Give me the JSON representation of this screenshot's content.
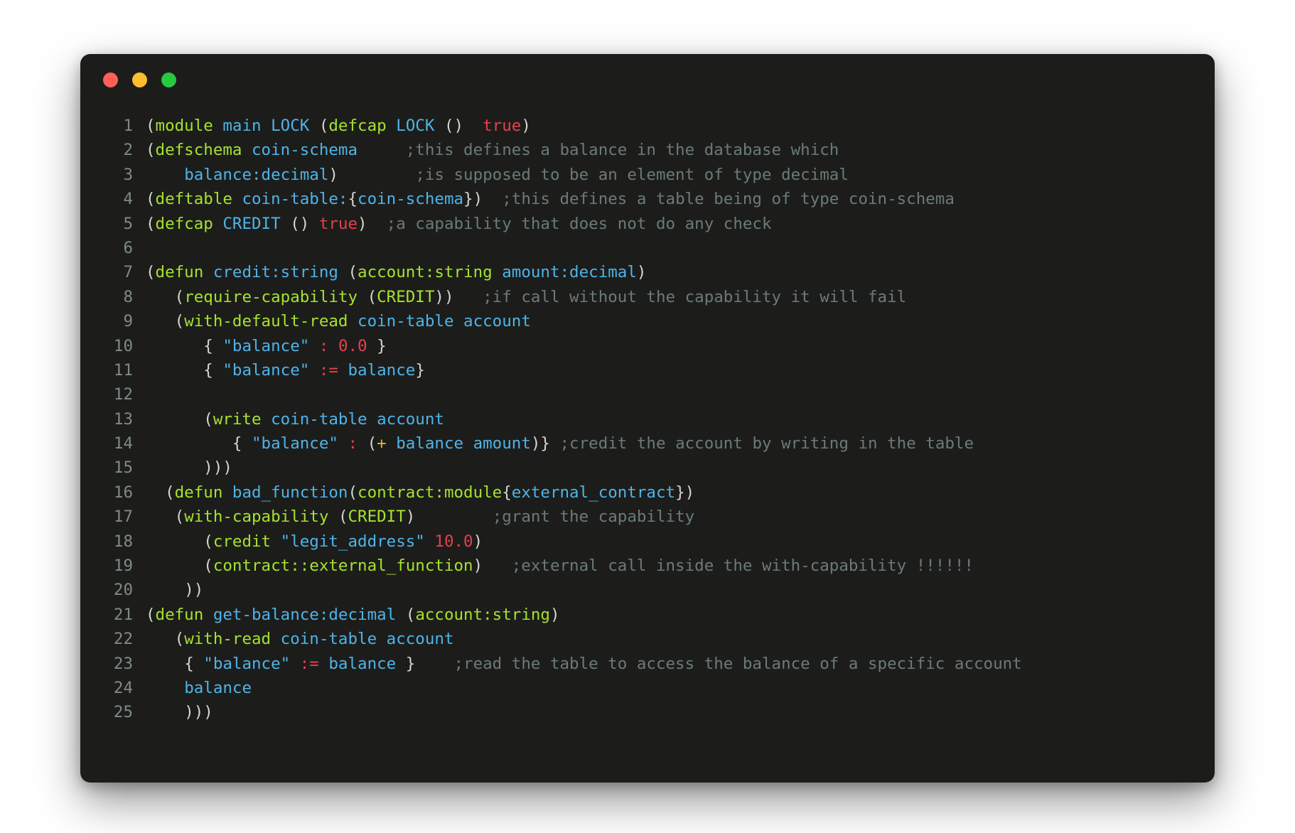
{
  "window": {
    "traffic_lights": [
      {
        "name": "close-button",
        "color": "#ff5f56"
      },
      {
        "name": "minimize-button",
        "color": "#ffbd2e"
      },
      {
        "name": "maximize-button",
        "color": "#27c93f"
      }
    ]
  },
  "editor": {
    "language": "pact",
    "background": "#1c1d1b",
    "gutter_color": "#7d8b87",
    "palette": {
      "keyword": "#a6e22e",
      "identifier": "#4fb3e8",
      "string": "#4fb3e8",
      "number": "#e5404a",
      "literal": "#e5404a",
      "operator": "#e5404a",
      "arith_operator": "#e6b422",
      "punctuation": "#d6d6d0",
      "comment": "#6b7a78"
    },
    "lines": [
      {
        "number": "1",
        "tokens": [
          {
            "t": "(",
            "c": "punc"
          },
          {
            "t": "module",
            "c": "kw"
          },
          {
            "t": " ",
            "c": "plain"
          },
          {
            "t": "main LOCK",
            "c": "id"
          },
          {
            "t": " ",
            "c": "plain"
          },
          {
            "t": "(",
            "c": "punc"
          },
          {
            "t": "defcap",
            "c": "kw"
          },
          {
            "t": " ",
            "c": "plain"
          },
          {
            "t": "LOCK",
            "c": "id"
          },
          {
            "t": " ",
            "c": "plain"
          },
          {
            "t": "()",
            "c": "punc"
          },
          {
            "t": "  ",
            "c": "plain"
          },
          {
            "t": "true",
            "c": "lit"
          },
          {
            "t": ")",
            "c": "punc"
          }
        ]
      },
      {
        "number": "2",
        "tokens": [
          {
            "t": "(",
            "c": "punc"
          },
          {
            "t": "defschema",
            "c": "kw"
          },
          {
            "t": " ",
            "c": "plain"
          },
          {
            "t": "coin-schema",
            "c": "id"
          },
          {
            "t": "     ",
            "c": "plain"
          },
          {
            "t": ";this defines a balance in the database which",
            "c": "cmt"
          }
        ]
      },
      {
        "number": "3",
        "tokens": [
          {
            "t": "    ",
            "c": "plain"
          },
          {
            "t": "balance:decimal",
            "c": "id"
          },
          {
            "t": ")",
            "c": "punc"
          },
          {
            "t": "        ",
            "c": "plain"
          },
          {
            "t": ";is supposed to be an element of type decimal",
            "c": "cmt"
          }
        ]
      },
      {
        "number": "4",
        "tokens": [
          {
            "t": "(",
            "c": "punc"
          },
          {
            "t": "deftable",
            "c": "kw"
          },
          {
            "t": " ",
            "c": "plain"
          },
          {
            "t": "coin-table:",
            "c": "id"
          },
          {
            "t": "{",
            "c": "punc"
          },
          {
            "t": "coin-schema",
            "c": "id"
          },
          {
            "t": "})",
            "c": "punc"
          },
          {
            "t": "  ",
            "c": "plain"
          },
          {
            "t": ";this defines a table being of type coin-schema",
            "c": "cmt"
          }
        ]
      },
      {
        "number": "5",
        "tokens": [
          {
            "t": "(",
            "c": "punc"
          },
          {
            "t": "defcap",
            "c": "kw"
          },
          {
            "t": " ",
            "c": "plain"
          },
          {
            "t": "CREDIT",
            "c": "id"
          },
          {
            "t": " ",
            "c": "plain"
          },
          {
            "t": "()",
            "c": "punc"
          },
          {
            "t": " ",
            "c": "plain"
          },
          {
            "t": "true",
            "c": "lit"
          },
          {
            "t": ")",
            "c": "punc"
          },
          {
            "t": "  ",
            "c": "plain"
          },
          {
            "t": ";a capability that does not do any check",
            "c": "cmt"
          }
        ]
      },
      {
        "number": "6",
        "tokens": []
      },
      {
        "number": "7",
        "tokens": [
          {
            "t": "(",
            "c": "punc"
          },
          {
            "t": "defun",
            "c": "kw"
          },
          {
            "t": " ",
            "c": "plain"
          },
          {
            "t": "credit:string",
            "c": "id"
          },
          {
            "t": " ",
            "c": "plain"
          },
          {
            "t": "(",
            "c": "punc"
          },
          {
            "t": "account:string",
            "c": "kw"
          },
          {
            "t": " ",
            "c": "plain"
          },
          {
            "t": "amount:decimal",
            "c": "id"
          },
          {
            "t": ")",
            "c": "punc"
          }
        ]
      },
      {
        "number": "8",
        "tokens": [
          {
            "t": "   ",
            "c": "plain"
          },
          {
            "t": "(",
            "c": "punc"
          },
          {
            "t": "require-capability",
            "c": "kw"
          },
          {
            "t": " ",
            "c": "plain"
          },
          {
            "t": "(",
            "c": "punc"
          },
          {
            "t": "CREDIT",
            "c": "kw"
          },
          {
            "t": "))",
            "c": "punc"
          },
          {
            "t": "   ",
            "c": "plain"
          },
          {
            "t": ";if call without the capability it will fail",
            "c": "cmt"
          }
        ]
      },
      {
        "number": "9",
        "tokens": [
          {
            "t": "   ",
            "c": "plain"
          },
          {
            "t": "(",
            "c": "punc"
          },
          {
            "t": "with-default-read",
            "c": "kw"
          },
          {
            "t": " ",
            "c": "plain"
          },
          {
            "t": "coin-table account",
            "c": "id"
          }
        ]
      },
      {
        "number": "10",
        "tokens": [
          {
            "t": "      ",
            "c": "plain"
          },
          {
            "t": "{",
            "c": "punc"
          },
          {
            "t": " ",
            "c": "plain"
          },
          {
            "t": "\"balance\"",
            "c": "str"
          },
          {
            "t": " ",
            "c": "plain"
          },
          {
            "t": ":",
            "c": "op"
          },
          {
            "t": " ",
            "c": "plain"
          },
          {
            "t": "0.0",
            "c": "num"
          },
          {
            "t": " ",
            "c": "plain"
          },
          {
            "t": "}",
            "c": "punc"
          }
        ]
      },
      {
        "number": "11",
        "tokens": [
          {
            "t": "      ",
            "c": "plain"
          },
          {
            "t": "{",
            "c": "punc"
          },
          {
            "t": " ",
            "c": "plain"
          },
          {
            "t": "\"balance\"",
            "c": "str"
          },
          {
            "t": " ",
            "c": "plain"
          },
          {
            "t": ":=",
            "c": "op"
          },
          {
            "t": " ",
            "c": "plain"
          },
          {
            "t": "balance",
            "c": "id"
          },
          {
            "t": "}",
            "c": "punc"
          }
        ]
      },
      {
        "number": "12",
        "tokens": []
      },
      {
        "number": "13",
        "tokens": [
          {
            "t": "      ",
            "c": "plain"
          },
          {
            "t": "(",
            "c": "punc"
          },
          {
            "t": "write",
            "c": "kw"
          },
          {
            "t": " ",
            "c": "plain"
          },
          {
            "t": "coin-table account",
            "c": "id"
          }
        ]
      },
      {
        "number": "14",
        "tokens": [
          {
            "t": "         ",
            "c": "plain"
          },
          {
            "t": "{",
            "c": "punc"
          },
          {
            "t": " ",
            "c": "plain"
          },
          {
            "t": "\"balance\"",
            "c": "str"
          },
          {
            "t": " ",
            "c": "plain"
          },
          {
            "t": ":",
            "c": "op"
          },
          {
            "t": " ",
            "c": "plain"
          },
          {
            "t": "(",
            "c": "punc"
          },
          {
            "t": "+",
            "c": "plus"
          },
          {
            "t": " ",
            "c": "plain"
          },
          {
            "t": "balance amount",
            "c": "id"
          },
          {
            "t": ")}",
            "c": "punc"
          },
          {
            "t": " ",
            "c": "plain"
          },
          {
            "t": ";credit the account by writing in the table",
            "c": "cmt"
          }
        ]
      },
      {
        "number": "15",
        "tokens": [
          {
            "t": "      ",
            "c": "plain"
          },
          {
            "t": ")))",
            "c": "punc"
          }
        ]
      },
      {
        "number": "16",
        "tokens": [
          {
            "t": "  ",
            "c": "plain"
          },
          {
            "t": "(",
            "c": "punc"
          },
          {
            "t": "defun",
            "c": "kw"
          },
          {
            "t": " ",
            "c": "plain"
          },
          {
            "t": "bad_function",
            "c": "id"
          },
          {
            "t": "(",
            "c": "punc"
          },
          {
            "t": "contract:module",
            "c": "kw"
          },
          {
            "t": "{",
            "c": "punc"
          },
          {
            "t": "external_contract",
            "c": "id"
          },
          {
            "t": "})",
            "c": "punc"
          }
        ]
      },
      {
        "number": "17",
        "tokens": [
          {
            "t": "   ",
            "c": "plain"
          },
          {
            "t": "(",
            "c": "punc"
          },
          {
            "t": "with-capability",
            "c": "kw"
          },
          {
            "t": " ",
            "c": "plain"
          },
          {
            "t": "(",
            "c": "punc"
          },
          {
            "t": "CREDIT",
            "c": "kw"
          },
          {
            "t": ")",
            "c": "punc"
          },
          {
            "t": "        ",
            "c": "plain"
          },
          {
            "t": ";grant the capability",
            "c": "cmt"
          }
        ]
      },
      {
        "number": "18",
        "tokens": [
          {
            "t": "      ",
            "c": "plain"
          },
          {
            "t": "(",
            "c": "punc"
          },
          {
            "t": "credit",
            "c": "kw"
          },
          {
            "t": " ",
            "c": "plain"
          },
          {
            "t": "\"legit_address\"",
            "c": "str"
          },
          {
            "t": " ",
            "c": "plain"
          },
          {
            "t": "10.0",
            "c": "num"
          },
          {
            "t": ")",
            "c": "punc"
          }
        ]
      },
      {
        "number": "19",
        "tokens": [
          {
            "t": "      ",
            "c": "plain"
          },
          {
            "t": "(",
            "c": "punc"
          },
          {
            "t": "contract::external_function",
            "c": "kw"
          },
          {
            "t": ")",
            "c": "punc"
          },
          {
            "t": "   ",
            "c": "plain"
          },
          {
            "t": ";external call inside the with-capability !!!!!!",
            "c": "cmt"
          }
        ]
      },
      {
        "number": "20",
        "tokens": [
          {
            "t": "    ",
            "c": "plain"
          },
          {
            "t": "))",
            "c": "punc"
          }
        ]
      },
      {
        "number": "21",
        "tokens": [
          {
            "t": "(",
            "c": "punc"
          },
          {
            "t": "defun",
            "c": "kw"
          },
          {
            "t": " ",
            "c": "plain"
          },
          {
            "t": "get-balance:decimal",
            "c": "id"
          },
          {
            "t": " ",
            "c": "plain"
          },
          {
            "t": "(",
            "c": "punc"
          },
          {
            "t": "account:string",
            "c": "kw"
          },
          {
            "t": ")",
            "c": "punc"
          }
        ]
      },
      {
        "number": "22",
        "tokens": [
          {
            "t": "   ",
            "c": "plain"
          },
          {
            "t": "(",
            "c": "punc"
          },
          {
            "t": "with-read",
            "c": "kw"
          },
          {
            "t": " ",
            "c": "plain"
          },
          {
            "t": "coin-table account",
            "c": "id"
          }
        ]
      },
      {
        "number": "23",
        "tokens": [
          {
            "t": "    ",
            "c": "plain"
          },
          {
            "t": "{",
            "c": "punc"
          },
          {
            "t": " ",
            "c": "plain"
          },
          {
            "t": "\"balance\"",
            "c": "str"
          },
          {
            "t": " ",
            "c": "plain"
          },
          {
            "t": ":=",
            "c": "op"
          },
          {
            "t": " ",
            "c": "plain"
          },
          {
            "t": "balance",
            "c": "id"
          },
          {
            "t": " ",
            "c": "plain"
          },
          {
            "t": "}",
            "c": "punc"
          },
          {
            "t": "    ",
            "c": "plain"
          },
          {
            "t": ";read the table to access the balance of a specific account",
            "c": "cmt"
          }
        ]
      },
      {
        "number": "24",
        "tokens": [
          {
            "t": "    ",
            "c": "plain"
          },
          {
            "t": "balance",
            "c": "id"
          }
        ]
      },
      {
        "number": "25",
        "tokens": [
          {
            "t": "    ",
            "c": "plain"
          },
          {
            "t": ")))",
            "c": "punc"
          }
        ]
      }
    ]
  }
}
